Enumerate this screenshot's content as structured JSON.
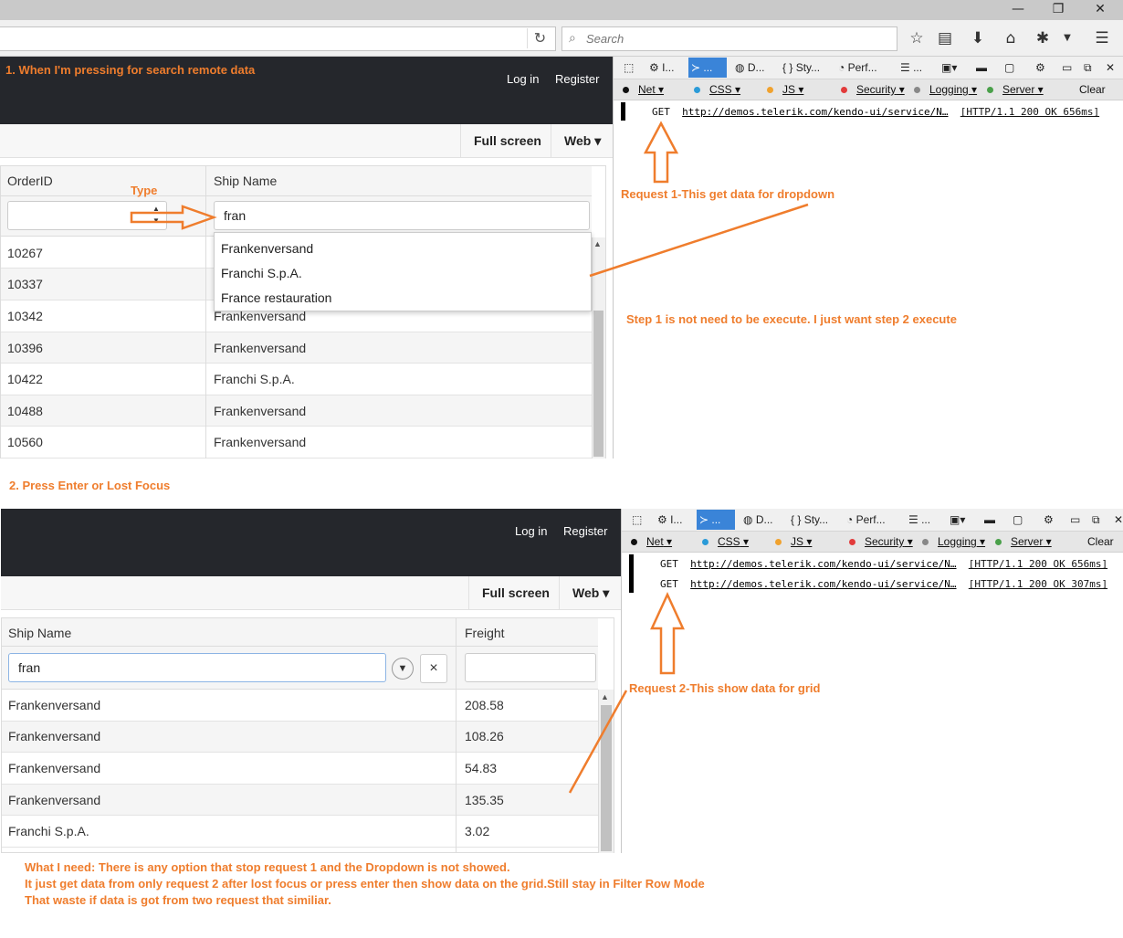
{
  "browser": {
    "search_placeholder": "Search",
    "reload_icon": "reload-icon"
  },
  "top": {
    "annotation_step1": "1. When I'm pressing for search remote data",
    "login": "Log in",
    "register": "Register",
    "fullscreen": "Full screen",
    "web": "Web ▾",
    "columns": [
      "OrderID",
      "Ship Name"
    ],
    "type_label": "Type",
    "filter_value": "fran",
    "dropdown_items": [
      "Frankenversand",
      "Franchi S.p.A.",
      "France restauration"
    ],
    "rows": [
      {
        "id": "10267",
        "name": ""
      },
      {
        "id": "10337",
        "name": ""
      },
      {
        "id": "10342",
        "name": "Frankenversand"
      },
      {
        "id": "10396",
        "name": "Frankenversand"
      },
      {
        "id": "10422",
        "name": "Franchi S.p.A."
      },
      {
        "id": "10488",
        "name": "Frankenversand"
      },
      {
        "id": "10560",
        "name": "Frankenversand"
      }
    ]
  },
  "devtools_top": {
    "tabs": [
      "I...",
      "...",
      "D...",
      "Sty...",
      "Perf...",
      "..."
    ],
    "filters": [
      "Net",
      "CSS",
      "JS",
      "Security",
      "Logging",
      "Server"
    ],
    "clear": "Clear",
    "log": [
      {
        "method": "GET",
        "url": "http://demos.telerik.com/kendo-ui/service/N…",
        "status": "[HTTP/1.1 200 OK 656ms]"
      }
    ],
    "annotation_request": "Request 1-This get data for dropdown",
    "annotation_step": "Step 1 is not need to be execute. I just want step 2 execute"
  },
  "middle": {
    "annotation_step2": "2. Press Enter or Lost Focus"
  },
  "bottom": {
    "login": "Log in",
    "register": "Register",
    "fullscreen": "Full screen",
    "web": "Web ▾",
    "columns": [
      "Ship Name",
      "Freight"
    ],
    "filter_value": "fran",
    "clear_x": "×",
    "rows": [
      {
        "name": "Frankenversand",
        "freight": "208.58"
      },
      {
        "name": "Frankenversand",
        "freight": "108.26"
      },
      {
        "name": "Frankenversand",
        "freight": "54.83"
      },
      {
        "name": "Frankenversand",
        "freight": "135.35"
      },
      {
        "name": "Franchi S.p.A.",
        "freight": "3.02"
      }
    ]
  },
  "devtools_bottom": {
    "tabs": [
      "I...",
      "...",
      "D...",
      "Sty...",
      "Perf...",
      "..."
    ],
    "filters": [
      "Net",
      "CSS",
      "JS",
      "Security",
      "Logging",
      "Server"
    ],
    "clear": "Clear",
    "log": [
      {
        "method": "GET",
        "url": "http://demos.telerik.com/kendo-ui/service/N…",
        "status": "[HTTP/1.1 200 OK 656ms]"
      },
      {
        "method": "GET",
        "url": "http://demos.telerik.com/kendo-ui/service/N…",
        "status": "[HTTP/1.1 200 OK 307ms]"
      }
    ],
    "annotation_request": "Request 2-This show data for grid"
  },
  "footer_note": {
    "line1": "What I need: There is any option that stop request 1 and the Dropdown is not showed.",
    "line2": "It just get data from only request 2 after lost focus or press enter then show data on the grid.Still stay in Filter Row Mode",
    "line3": "That waste if data is got from two request that similiar."
  },
  "colors": {
    "annotation": "#ef7d2d",
    "header_dark": "#25272c",
    "devtools_active": "#3a84d8"
  }
}
